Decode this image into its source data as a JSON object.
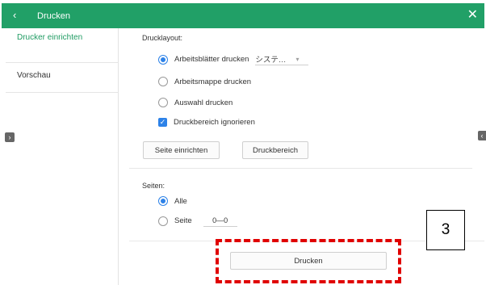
{
  "window": {
    "title": "Drucken",
    "back_icon": "chevron-left-icon",
    "close_icon": "close-icon"
  },
  "sidebar": {
    "items": [
      {
        "label": "Drucker einrichten"
      },
      {
        "label": "Vorschau"
      }
    ]
  },
  "layout_section": {
    "label": "Drucklayout:",
    "options": [
      {
        "label": "Arbeitsblätter drucken",
        "selected": true
      },
      {
        "label": "Arbeitsmappe drucken",
        "selected": false
      },
      {
        "label": "Auswahl drucken",
        "selected": false
      }
    ],
    "dropdown": {
      "value": "システ…"
    },
    "checkbox": {
      "label": "Druckbereich ignorieren",
      "checked": true
    },
    "buttons": {
      "page_setup": "Seite einrichten",
      "print_area": "Druckbereich"
    }
  },
  "pages_section": {
    "label": "Seiten:",
    "options": [
      {
        "label": "Alle",
        "selected": true
      },
      {
        "label": "Seite",
        "selected": false
      }
    ],
    "range_value": "0—0"
  },
  "footer": {
    "print_button": "Drucken"
  },
  "annotation": {
    "callout_number": "3"
  },
  "colors": {
    "accent": "#21a067",
    "selection": "#2d82e8",
    "highlight": "#e00000"
  }
}
